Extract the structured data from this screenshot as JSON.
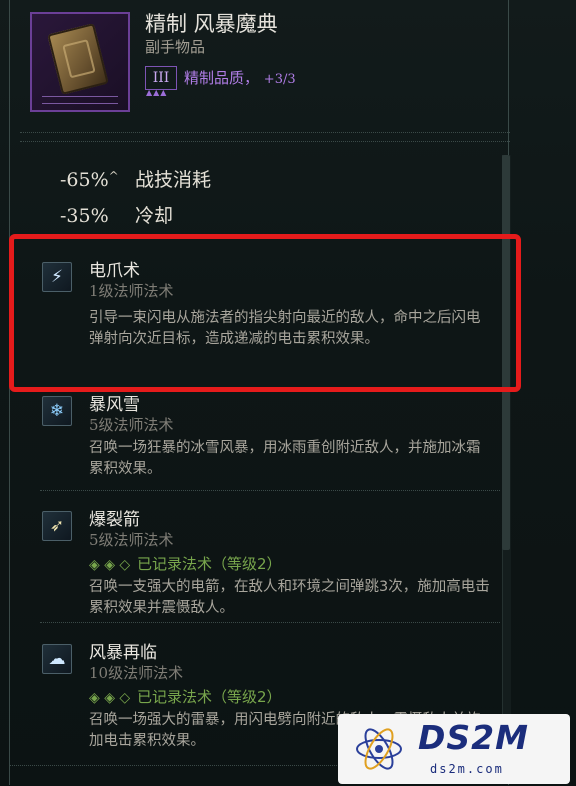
{
  "item": {
    "name": "精制 风暴魔典",
    "type": "副手物品",
    "tier": "III",
    "quality_label": "精制品质，",
    "quality_value": "+3/3"
  },
  "stats": [
    {
      "value": "-65%",
      "marker": "^",
      "label": "战技消耗"
    },
    {
      "value": "-35%",
      "marker": "",
      "label": "冷却"
    }
  ],
  "skills": [
    {
      "name": "电爪术",
      "level_num": "1",
      "level_suffix": "级法师法术",
      "recorded": "",
      "description": "引导一束闪电从施法者的指尖射向最近的敌人，命中之后闪电弹射向次近目标，造成递减的电击累积效果。",
      "icon": "lightning-claw-icon"
    },
    {
      "name": "暴风雪",
      "level_num": "5",
      "level_suffix": "级法师法术",
      "recorded": "",
      "description": "召唤一场狂暴的冰雪风暴，用冰雨重创附近敌人，并施加冰霜累积效果。",
      "icon": "blizzard-icon"
    },
    {
      "name": "爆裂箭",
      "level_num": "5",
      "level_suffix": "级法师法术",
      "recorded_gems": "◈ ◈ ◇",
      "recorded": "已记录法术（等级2）",
      "description": "召唤一支强大的电箭，在敌人和环境之间弹跳3次，施加高电击累积效果并震慑敌人。",
      "icon": "chain-bolt-icon"
    },
    {
      "name": "风暴再临",
      "level_num": "10",
      "level_suffix": "级法师法术",
      "recorded_gems": "◈ ◈ ◇",
      "recorded": "已记录法术（等级2）",
      "description": "召唤一场强大的雷暴，用闪电劈向附近的敌人，震慑敌人并施加电击累积效果。",
      "icon": "storm-cloud-icon"
    }
  ],
  "watermark": {
    "brand": "DS2M",
    "domain": "ds2m.com"
  },
  "colors": {
    "highlight": "#e51b1b",
    "quality": "#b07de6",
    "recorded": "#78a64c"
  }
}
